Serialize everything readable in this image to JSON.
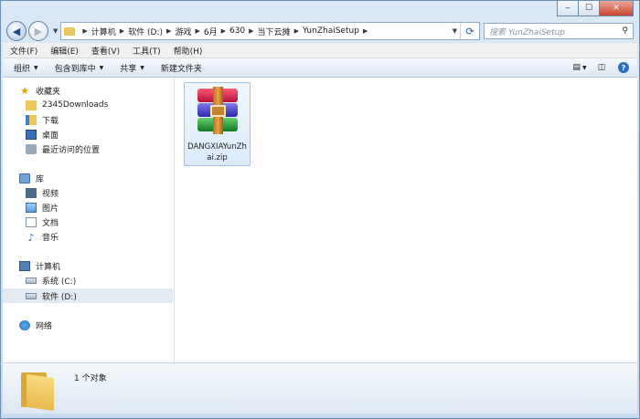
{
  "window": {
    "minimize": "‒",
    "maximize": "☐",
    "close": "✕"
  },
  "address": {
    "breadcrumbs": [
      "计算机",
      "软件 (D:)",
      "游戏",
      "6月",
      "630",
      "当下云摊",
      "YunZhaiSetup"
    ],
    "search_placeholder": "搜索 YunZhaiSetup"
  },
  "menu": [
    "文件(F)",
    "编辑(E)",
    "查看(V)",
    "工具(T)",
    "帮助(H)"
  ],
  "toolbar": {
    "organize": "组织",
    "include_in_library": "包含到库中",
    "share": "共享",
    "new_folder": "新建文件夹"
  },
  "nav": {
    "favorites": "收藏夹",
    "fav_items": [
      "2345Downloads",
      "下载",
      "桌面",
      "最近访问的位置"
    ],
    "libraries": "库",
    "lib_items": [
      "视频",
      "图片",
      "文档",
      "音乐"
    ],
    "computer": "计算机",
    "drives": [
      "系统 (C:)",
      "软件 (D:)"
    ],
    "network": "网络"
  },
  "files": [
    {
      "name": "DANGXIAYunZhai.zip",
      "icon": "winrar-archive-icon"
    }
  ],
  "details": {
    "count": "1 个对象"
  },
  "colors": {
    "selection": "#e4eaf1",
    "tile_border": "#9fc3e6",
    "accent": "#2d6fbf"
  }
}
